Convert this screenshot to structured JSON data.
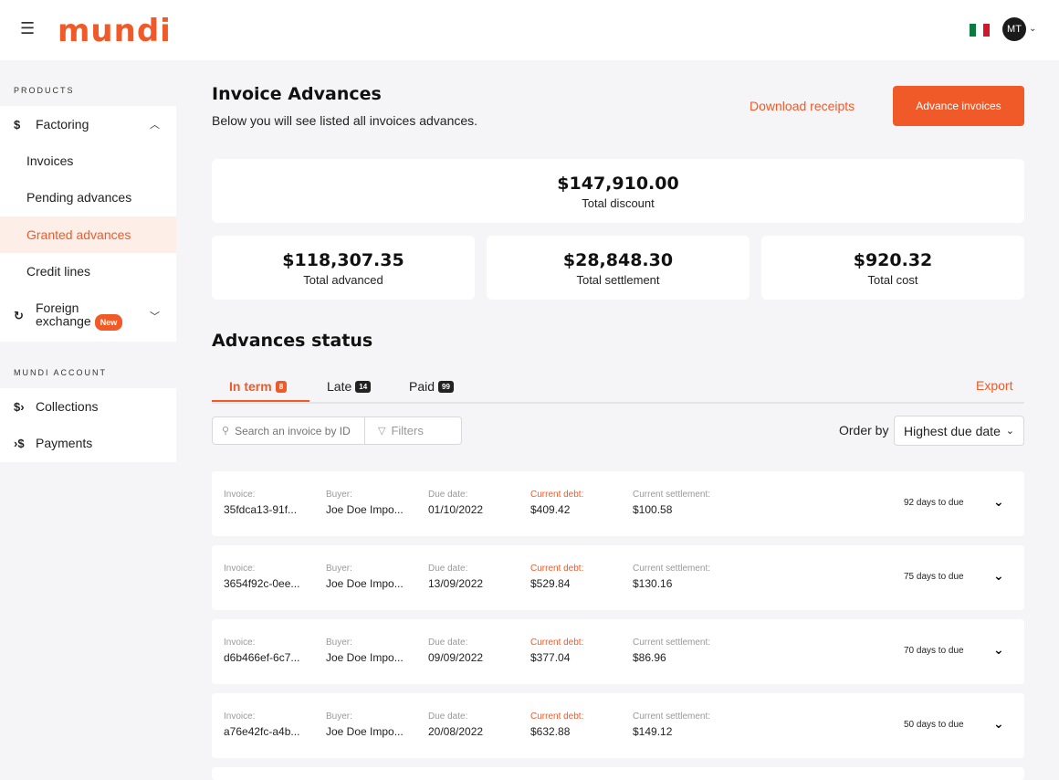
{
  "header": {
    "logo": "mundi",
    "avatar_initials": "MT",
    "flag_colors": [
      "#0a7a3e",
      "#ffffff",
      "#d4162c"
    ]
  },
  "sidebar": {
    "products_title": "PRODUCTS",
    "factoring_label": "Factoring",
    "factoring_items": [
      "Invoices",
      "Pending advances",
      "Granted advances",
      "Credit lines"
    ],
    "active_item": "Granted advances",
    "foreign_exchange_label_1": "Foreign",
    "foreign_exchange_label_2": "exchange",
    "new_badge": "New",
    "account_title": "MUNDI ACCOUNT",
    "collections_label": "Collections",
    "payments_label": "Payments"
  },
  "main": {
    "title": "Invoice Advances",
    "subtitle": "Below you will see listed all invoices advances.",
    "download_receipts": "Download receipts",
    "advance_invoices": "Advance invoices",
    "total_discount": {
      "value": "$147,910.00",
      "label": "Total discount"
    },
    "total_advanced": {
      "value": "$118,307.35",
      "label": "Total advanced"
    },
    "total_settlement": {
      "value": "$28,848.30",
      "label": "Total settlement"
    },
    "total_cost": {
      "value": "$920.32",
      "label": "Total cost"
    },
    "section_title": "Advances status",
    "tabs": [
      {
        "label": "In term",
        "count": "8"
      },
      {
        "label": "Late",
        "count": "14"
      },
      {
        "label": "Paid",
        "count": "99"
      }
    ],
    "export": "Export",
    "search_placeholder": "Search an invoice by ID",
    "filters": "Filters",
    "order_by_label": "Order by",
    "order_by_value": "Highest due date",
    "column_labels": {
      "invoice": "Invoice:",
      "buyer": "Buyer:",
      "due_date": "Due date:",
      "current_debt": "Current debt:",
      "current_settlement": "Current settlement:"
    },
    "rows": [
      {
        "invoice": "35fdca13-91f...",
        "buyer": "Joe Doe Impo...",
        "due_date": "01/10/2022",
        "current_debt": "$409.42",
        "current_settlement": "$100.58",
        "days": "92 days to due"
      },
      {
        "invoice": "3654f92c-0ee...",
        "buyer": "Joe Doe Impo...",
        "due_date": "13/09/2022",
        "current_debt": "$529.84",
        "current_settlement": "$130.16",
        "days": "75 days to due"
      },
      {
        "invoice": "d6b466ef-6c7...",
        "buyer": "Joe Doe Impo...",
        "due_date": "09/09/2022",
        "current_debt": "$377.04",
        "current_settlement": "$86.96",
        "days": "70 days to due"
      },
      {
        "invoice": "a76e42fc-a4b...",
        "buyer": "Joe Doe Impo...",
        "due_date": "20/08/2022",
        "current_debt": "$632.88",
        "current_settlement": "$149.12",
        "days": "50 days to due"
      }
    ],
    "accent_color": "#f05a28"
  }
}
